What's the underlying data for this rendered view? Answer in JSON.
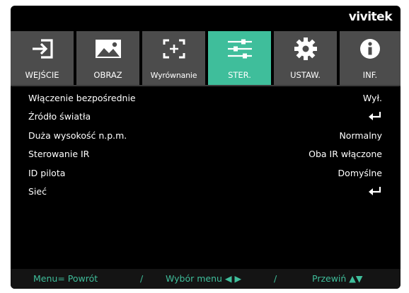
{
  "brand": "vivitek",
  "colors": {
    "accent": "#3fbe9b",
    "tab_bg": "#4c4c4c",
    "background": "#000000"
  },
  "tabs": [
    {
      "label": "WEJŚCIE",
      "icon": "input-icon",
      "active": false
    },
    {
      "label": "OBRAZ",
      "icon": "image-icon",
      "active": false
    },
    {
      "label": "Wyrównanie",
      "icon": "alignment-icon",
      "active": false
    },
    {
      "label": "STER.",
      "icon": "sliders-icon",
      "active": true
    },
    {
      "label": "USTAW.",
      "icon": "gear-icon",
      "active": false
    },
    {
      "label": "INF.",
      "icon": "info-icon",
      "active": false
    }
  ],
  "menu": [
    {
      "label": "Włączenie bezpośrednie",
      "value": "Wył."
    },
    {
      "label": "Źródło światła",
      "value": "",
      "icon": "enter-icon"
    },
    {
      "label": "Duża wysokość n.p.m.",
      "value": "Normalny"
    },
    {
      "label": "Sterowanie IR",
      "value": "Oba IR włączone"
    },
    {
      "label": "ID pilota",
      "value": "Domyślne"
    },
    {
      "label": "Sieć",
      "value": "",
      "icon": "enter-icon"
    }
  ],
  "footer": {
    "back": "Menu= Powrót",
    "sep1": "/",
    "select": "Wybór menu ◀ ▶",
    "sep2": "/",
    "scroll": "Przewiń ▲▼"
  }
}
